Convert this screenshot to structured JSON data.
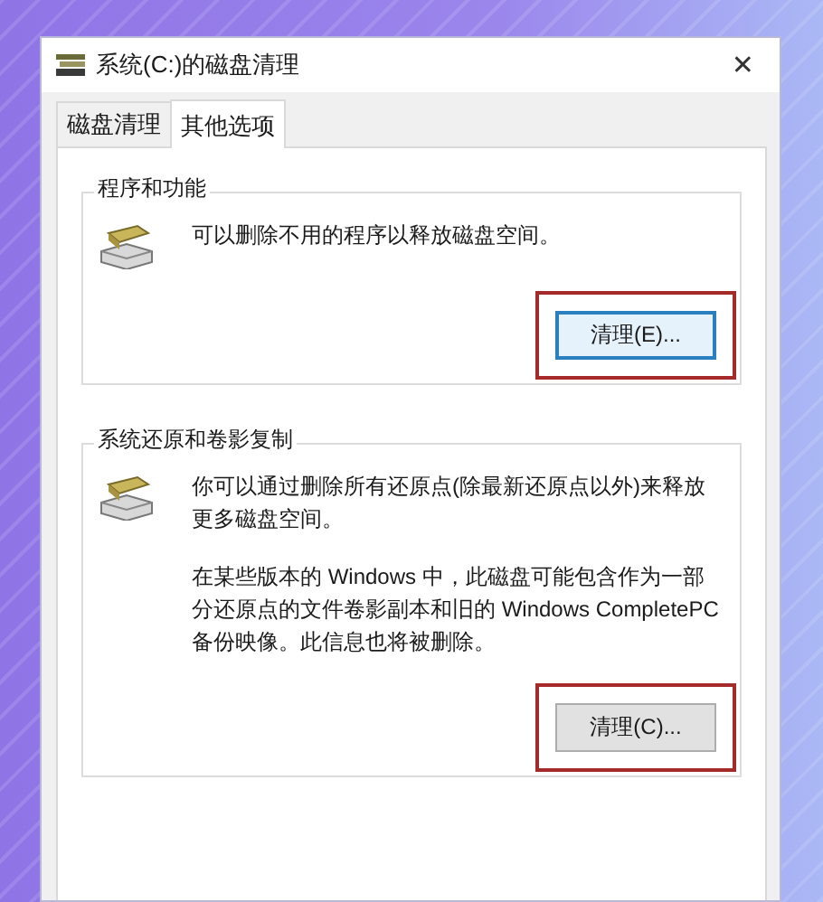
{
  "window": {
    "title": "系统(C:)的磁盘清理",
    "close": "✕"
  },
  "tabs": [
    {
      "label": "磁盘清理",
      "selected": false
    },
    {
      "label": "其他选项",
      "selected": true
    }
  ],
  "groups": [
    {
      "title": "程序和功能",
      "paragraphs": [
        "可以删除不用的程序以释放磁盘空间。"
      ],
      "button": {
        "label": "清理(E)...",
        "focused": true,
        "highlighted": true
      }
    },
    {
      "title": "系统还原和卷影复制",
      "paragraphs": [
        "你可以通过删除所有还原点(除最新还原点以外)来释放更多磁盘空间。",
        "在某些版本的 Windows 中，此磁盘可能包含作为一部分还原点的文件卷影副本和旧的 Windows CompletePC 备份映像。此信息也将被删除。"
      ],
      "button": {
        "label": "清理(C)...",
        "focused": false,
        "highlighted": true
      }
    }
  ]
}
